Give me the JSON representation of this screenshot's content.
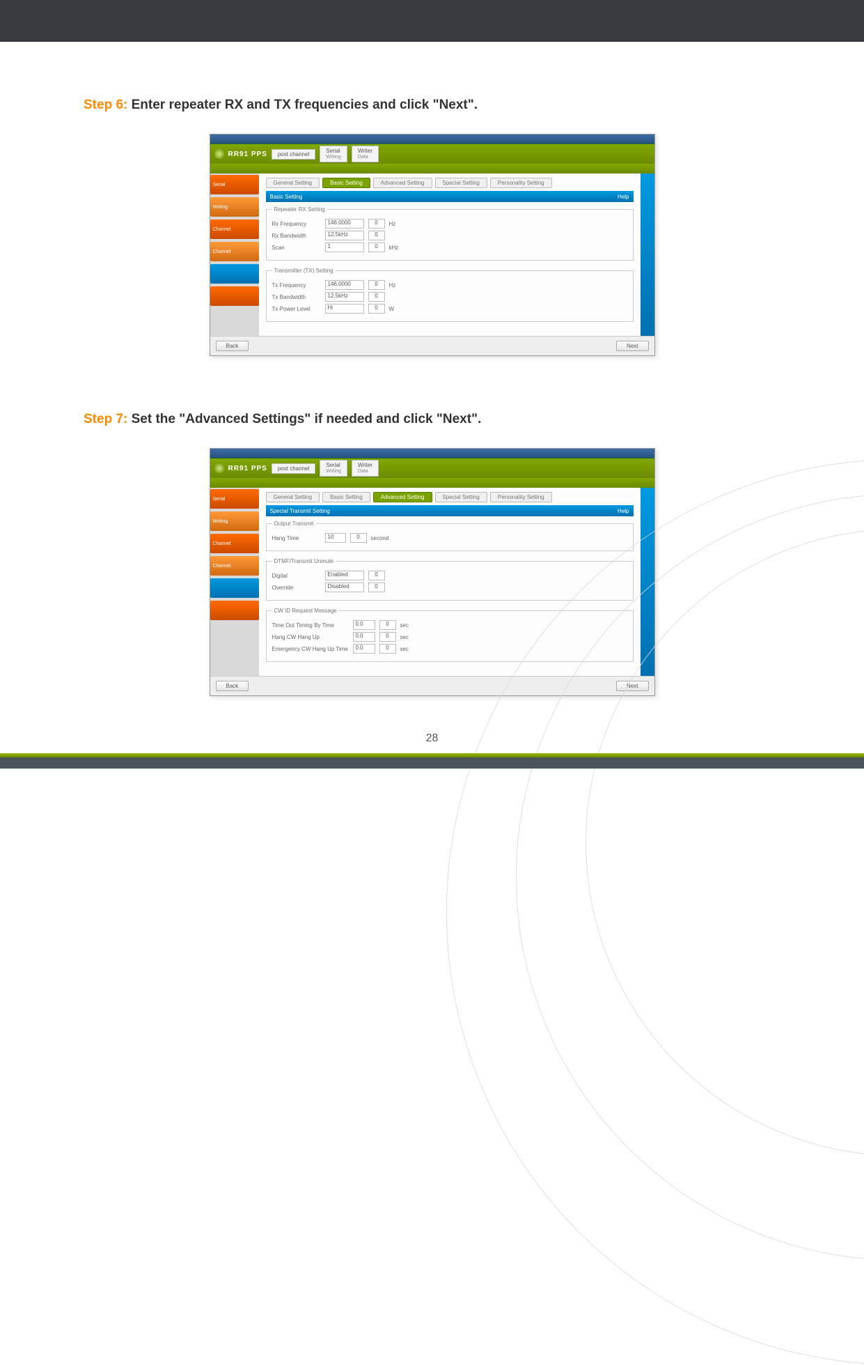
{
  "page_number": "28",
  "step6": {
    "label": "Step 6:",
    "text": " Enter repeater RX and TX frequencies and click \"Next\"."
  },
  "step7": {
    "label": "Step 7:",
    "text": " Set the \"Advanced Settings\" if needed and click \"Next\"."
  },
  "shot_a": {
    "brand": "RR91 PPS",
    "hdr_tab1_top": "post channel",
    "hdr_tab2_top": "Serial",
    "hdr_tab2_sub": "Writing",
    "hdr_tab3_top": "Writer",
    "hdr_tab3_sub": "Data",
    "side": [
      "Serial",
      "Writing",
      "Channel",
      "Channel",
      "",
      ""
    ],
    "tabs": [
      "General Setting",
      "Basic Setting",
      "Advanced Setting",
      "Special Setting",
      "Personality Setting"
    ],
    "active_tab_index": 1,
    "section_title": "Basic Setting",
    "section_help": "Help",
    "grp1_title": "Repeater RX Setting",
    "grp1": {
      "r1_label": "Rx Frequency",
      "r1_val": "146.0000",
      "r1_sel": "0",
      "r1_unit": "Hz",
      "r2_label": "Rx Bandwidth",
      "r2_val": "12.5kHz",
      "r2_sel": "0",
      "r3_label": "Scan",
      "r3_val": "1",
      "r3_sel": "0",
      "r3_unit": "kHz"
    },
    "grp2_title": "Transmitter (TX) Setting",
    "grp2": {
      "r1_label": "Tx Frequency",
      "r1_val": "146.0000",
      "r1_sel": "0",
      "r1_unit": "Hz",
      "r2_label": "Tx Bandwidth",
      "r2_val": "12.5kHz",
      "r2_sel": "0",
      "r3_label": "Tx Power Level",
      "r3_val": "Hi",
      "r3_sel": "0",
      "r3_unit": "W"
    },
    "back": "Back",
    "next": "Next"
  },
  "shot_b": {
    "brand": "RR91 PPS",
    "hdr_tab1_top": "post channel",
    "hdr_tab2_top": "Serial",
    "hdr_tab2_sub": "Writing",
    "hdr_tab3_top": "Writer",
    "hdr_tab3_sub": "Data",
    "side": [
      "Serial",
      "Writing",
      "Channel",
      "Channel",
      "",
      ""
    ],
    "tabs": [
      "General Setting",
      "Basic Setting",
      "Advanced Setting",
      "Special Setting",
      "Personality Setting"
    ],
    "active_tab_index": 2,
    "section_title": "Special Transmit Setting",
    "section_help": "Help",
    "grp1_title": "Output Transmit",
    "grp1": {
      "label": "Hang Time",
      "val": "10",
      "sel": "0",
      "unit": "second"
    },
    "grp2_title": "DTMF/Transmit Unmute",
    "grp2": {
      "r1_label": "Digital",
      "r1_val": "Enabled",
      "r1_sel": "0",
      "r2_label": "Override",
      "r2_val": "Disabled",
      "r2_sel": "0"
    },
    "grp3_title": "CW ID Request Message",
    "grp3": {
      "r1_label": "Time Out Timing By Time",
      "r1_val": "0.0",
      "r1_sel": "0",
      "r1_unit": "sec",
      "r2_label": "Hang CW Hang Up",
      "r2_val": "0.0",
      "r2_sel": "0",
      "r2_unit": "sec",
      "r3_label": "Emergency CW Hang Up Time",
      "r3_val": "0.0",
      "r3_sel": "0",
      "r3_unit": "sec"
    },
    "back": "Back",
    "next": "Next"
  }
}
